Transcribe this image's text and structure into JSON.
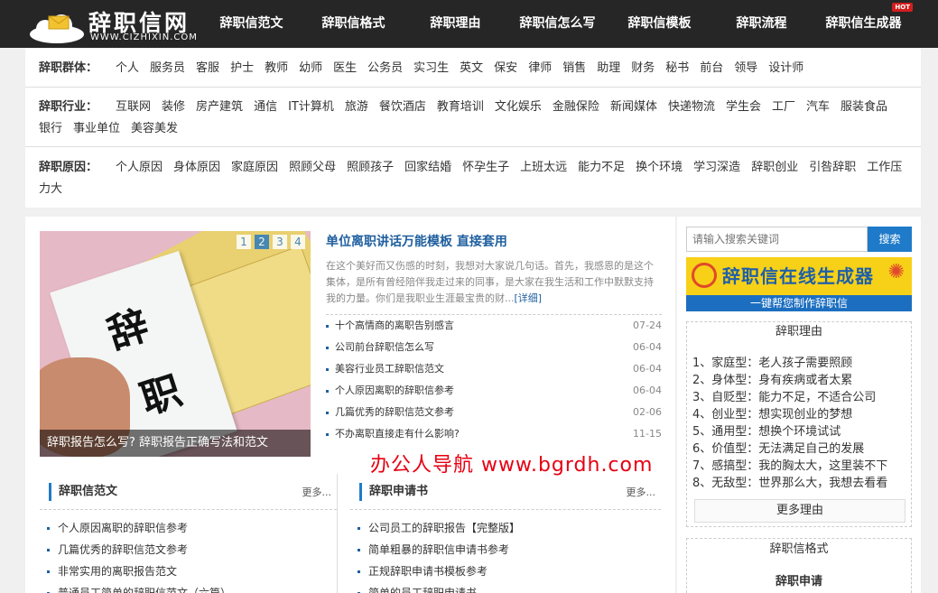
{
  "header": {
    "logo_title": "辞职信网",
    "logo_domain": "WWW.CIZHIXIN.COM",
    "nav": [
      "辞职信范文",
      "辞职信格式",
      "辞职理由",
      "辞职信怎么写",
      "辞职信模板",
      "辞职流程",
      "辞职信生成器"
    ],
    "hot_badge": "HOT"
  },
  "categories": {
    "group": {
      "label": "辞职群体：",
      "items": [
        "个人",
        "服务员",
        "客服",
        "护士",
        "教师",
        "幼师",
        "医生",
        "公务员",
        "实习生",
        "英文",
        "保安",
        "律师",
        "销售",
        "助理",
        "财务",
        "秘书",
        "前台",
        "领导",
        "设计师"
      ]
    },
    "industry": {
      "label": "辞职行业：",
      "items": [
        "互联网",
        "装修",
        "房产建筑",
        "通信",
        "IT计算机",
        "旅游",
        "餐饮酒店",
        "教育培训",
        "文化娱乐",
        "金融保险",
        "新闻媒体",
        "快递物流",
        "学生会",
        "工厂",
        "汽车",
        "服装食品",
        "银行",
        "事业单位",
        "美容美发"
      ]
    },
    "reason": {
      "label": "辞职原因：",
      "items": [
        "个人原因",
        "身体原因",
        "家庭原因",
        "照顾父母",
        "照顾孩子",
        "回家结婚",
        "怀孕生子",
        "上班太远",
        "能力不足",
        "换个环境",
        "学习深造",
        "辞职创业",
        "引咎辞职",
        "工作压力大"
      ]
    }
  },
  "slider": {
    "pages": [
      "1",
      "2",
      "3",
      "4"
    ],
    "active_page": 2,
    "caption": "辞职报告怎么写? 辞职报告正确写法和范文",
    "chars": [
      "辞",
      "职"
    ]
  },
  "featured": {
    "title": "单位离职讲话万能模板 直接套用",
    "summary": "在这个美好而又伤感的时刻，我想对大家说几句话。首先，我感恩的是这个集体，是所有曾经陪伴我走过来的同事，是大家在我生活和工作中默默支持我的力量。你们是我职业生涯最宝贵的财...",
    "more": "[详细]",
    "list": [
      {
        "title": "十个高情商的离职告别感言",
        "date": "07-24"
      },
      {
        "title": "公司前台辞职信怎么写",
        "date": "06-04"
      },
      {
        "title": "美容行业员工辞职信范文",
        "date": "06-04"
      },
      {
        "title": "个人原因离职的辞职信参考",
        "date": "06-04"
      },
      {
        "title": "几篇优秀的辞职信范文参考",
        "date": "02-06"
      },
      {
        "title": "不办离职直接走有什么影响?",
        "date": "11-15"
      }
    ]
  },
  "section1": {
    "title": "辞职信范文",
    "more": "更多...",
    "items": [
      "个人原因离职的辞职信参考",
      "几篇优秀的辞职信范文参考",
      "非常实用的离职报告范文",
      "普通员工简单的辞职信范文（六篇）"
    ]
  },
  "section2": {
    "title": "辞职申请书",
    "more": "更多...",
    "items": [
      "公司员工的辞职报告【完整版】",
      "简单粗暴的辞职信申请书参考",
      "正规辞职申请书模板参考",
      "简单的员工辞职申请书"
    ]
  },
  "watermark": "办公人导航  www.bgrdh.com",
  "sidebar": {
    "search_placeholder": "请输入搜索关键词",
    "search_button": "搜索",
    "banner_title": "辞职信在线生成器",
    "banner_sub": "一键帮您制作辞职信",
    "reasons_title": "辞职理由",
    "reasons": [
      "1、家庭型：老人孩子需要照顾",
      "2、身体型：身有疾病或者太累",
      "3、自贬型：能力不足，不适合公司",
      "4、创业型：想实现创业的梦想",
      "5、通用型：想换个环境试试",
      "6、价值型：无法满足自己的发展",
      "7、感搞型：我的胸太大，这里装不下",
      "8、无敌型：世界那么大，我想去看看"
    ],
    "reasons_more": "更多理由",
    "format_title": "辞职信格式",
    "format_sub": "辞职申请"
  },
  "colors": {
    "topbar": "#262626",
    "accent": "#1f7bc9",
    "link": "#1f5f9f",
    "watermark": "#e60012",
    "banner": "#f7d117"
  }
}
